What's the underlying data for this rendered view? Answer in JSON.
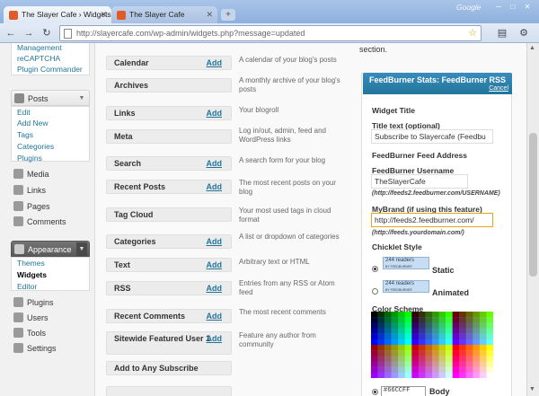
{
  "browser": {
    "tabs": [
      {
        "title": "The Slayer Cafe › Widgets ..."
      },
      {
        "title": "The Slayer Cafe"
      }
    ],
    "brand": "Google",
    "url": "http://slayercafe.com/wp-admin/widgets.php?message=updated"
  },
  "sidebar": {
    "top_items": [
      "Management",
      "reCAPTCHA",
      "Plugin Commander"
    ],
    "posts": {
      "label": "Posts",
      "subitems": [
        "Edit",
        "Add New",
        "Tags",
        "Categories",
        "Plugins"
      ]
    },
    "menu": [
      "Media",
      "Links",
      "Pages",
      "Comments"
    ],
    "appearance": {
      "label": "Appearance",
      "subitems": [
        "Themes",
        "Widgets",
        "Editor"
      ],
      "current": "Widgets"
    },
    "bottom_menu": [
      "Plugins",
      "Users",
      "Tools",
      "Settings"
    ]
  },
  "widgets": [
    {
      "name": "Calendar",
      "add": "Add",
      "desc": "A calendar of your blog's posts"
    },
    {
      "name": "Archives",
      "add": "",
      "desc": "A monthly archive of your blog's posts"
    },
    {
      "name": "Links",
      "add": "Add",
      "desc": "Your blogroll"
    },
    {
      "name": "Meta",
      "add": "",
      "desc": "Log in/out, admin, feed and WordPress links"
    },
    {
      "name": "Search",
      "add": "Add",
      "desc": "A search form for your blog"
    },
    {
      "name": "Recent Posts",
      "add": "Add",
      "desc": "The most recent posts on your blog"
    },
    {
      "name": "Tag Cloud",
      "add": "",
      "desc": "Your most used tags in cloud format"
    },
    {
      "name": "Categories",
      "add": "Add",
      "desc": "A list or dropdown of categories"
    },
    {
      "name": "Text",
      "add": "Add",
      "desc": "Arbitrary text or HTML"
    },
    {
      "name": "RSS",
      "add": "Add",
      "desc": "Entries from any RSS or Atom feed"
    },
    {
      "name": "Recent Comments",
      "add": "Add",
      "desc": "The most recent comments"
    },
    {
      "name": "Sitewide Featured User 1",
      "add": "Add",
      "desc": "Feature any author from community"
    },
    {
      "name": "Add to Any Subscribe",
      "add": "",
      "desc": ""
    }
  ],
  "panel": {
    "section_text": "section.",
    "title": "FeedBurner Stats: FeedBurner RSS",
    "cancel": "Cancel",
    "widget_title_label": "Widget Title",
    "title_text_label": "Title text (optional)",
    "title_text_value": "Subscribe to Slayercafe (Feedbu",
    "feed_address_label": "FeedBurner Feed Address",
    "username_label": "FeedBurner Username",
    "username_value": "TheSlayerCafe",
    "username_hint": "(http://feeds2.feedburner.com/USERNAME)",
    "mybrand_label": "MyBrand (if using this feature)",
    "mybrand_value": "http://feeds2.feedburner.com/",
    "mybrand_hint": "(http://feeds.yourdomain.com/)",
    "chicklet_label": "Chicklet Style",
    "chicklet_count": "244 readers",
    "chicklet_by": "BY FEEDBURNER",
    "chicklet_static": "Static",
    "chicklet_animated": "Animated",
    "color_scheme_label": "Color Scheme",
    "hex_value": "#66CCFF",
    "body_label": "Body"
  }
}
